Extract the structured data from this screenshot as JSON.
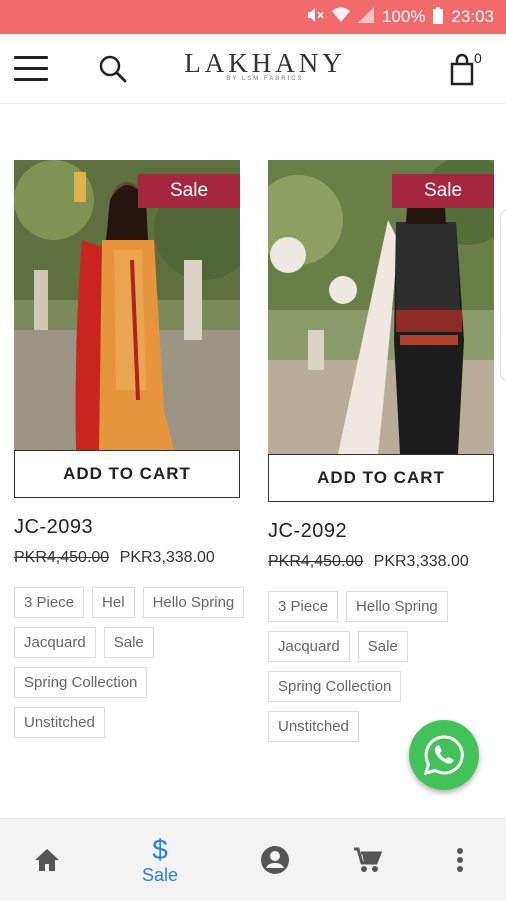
{
  "status_bar": {
    "battery": "100%",
    "time": "23:03"
  },
  "header": {
    "logo_text": "LAKHANY",
    "logo_sub": "BY LSM FABRICS",
    "cart_count": "0"
  },
  "products": [
    {
      "badge": "Sale",
      "add_to_cart": "ADD TO CART",
      "sku": "JC-2093",
      "old_price": "PKR4,450.00",
      "price": "PKR3,338.00",
      "tags": [
        "3 Piece",
        "Hel",
        "Hello Spring",
        "Jacquard",
        "Sale",
        "Spring Collection",
        "Unstitched"
      ]
    },
    {
      "badge": "Sale",
      "add_to_cart": "ADD TO CART",
      "sku": "JC-2092",
      "old_price": "PKR4,450.00",
      "price": "PKR3,338.00",
      "tags": [
        "3 Piece",
        "Hello Spring",
        "Jacquard",
        "Sale",
        "Spring Collection",
        "Unstitched"
      ]
    }
  ],
  "bottom_nav": {
    "items": [
      {
        "icon": "home-icon"
      },
      {
        "icon": "dollar-icon",
        "label": "Sale",
        "active": true
      },
      {
        "icon": "account-icon"
      },
      {
        "icon": "cart-icon"
      },
      {
        "icon": "more-icon"
      }
    ]
  },
  "colors": {
    "status_bar": "#f26b6b",
    "sale_badge": "#a5263f",
    "active_nav": "#2b7de0",
    "whatsapp": "#43c25a"
  }
}
